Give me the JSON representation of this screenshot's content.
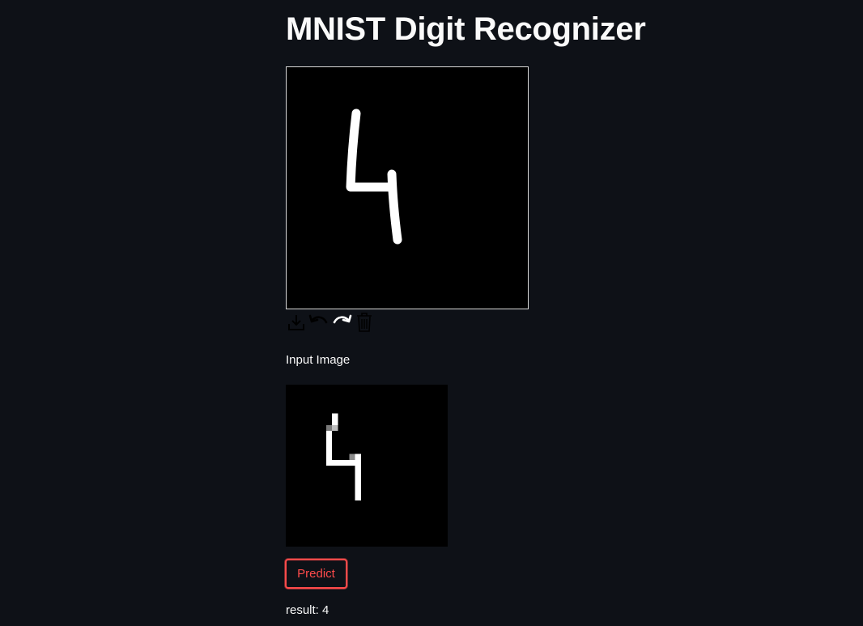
{
  "app": {
    "title": "MNIST Digit Recognizer"
  },
  "canvas": {
    "stroke_color": "#ffffff",
    "background_color": "#000000",
    "toolbar": [
      {
        "name": "download-icon",
        "title": "Send to Streamlit"
      },
      {
        "name": "undo-icon",
        "title": "Undo"
      },
      {
        "name": "redo-icon",
        "title": "Redo"
      },
      {
        "name": "trash-icon",
        "title": "Clear"
      }
    ]
  },
  "input_image": {
    "label": "Input Image"
  },
  "predict": {
    "label": "Predict"
  },
  "result": {
    "text": "result: 4"
  },
  "colors": {
    "background": "#0e1117",
    "accent": "#ff4b4b",
    "text": "#fafafa"
  }
}
